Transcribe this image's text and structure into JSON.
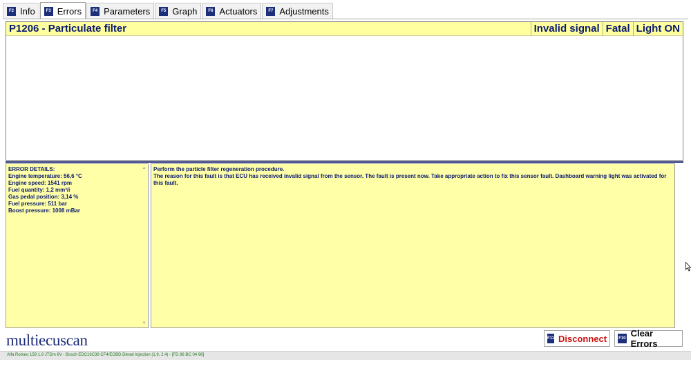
{
  "tabs": [
    {
      "key": "F2",
      "label": "Info"
    },
    {
      "key": "F3",
      "label": "Errors"
    },
    {
      "key": "F4",
      "label": "Parameters"
    },
    {
      "key": "F5",
      "label": "Graph"
    },
    {
      "key": "F6",
      "label": "Actuators"
    },
    {
      "key": "F7",
      "label": "Adjustments"
    }
  ],
  "active_tab": "Errors",
  "fault": {
    "title": "P1206 - Particulate filter",
    "type": "Invalid signal",
    "severity": "Fatal",
    "light": "Light ON"
  },
  "details": {
    "heading": "ERROR DETAILS:",
    "lines": [
      "Engine temperature: 56,6 °C",
      "Engine speed: 1541 rpm",
      "Fuel quantity: 1,2 mm³/i",
      "Gas pedal position: 3,14 %",
      "Fuel pressure: 511 bar",
      "Boost pressure: 1008 mBar"
    ]
  },
  "description": {
    "line1": "Perform the particle filter regeneration procedure.",
    "line2": "The reason for this fault is that ECU has received invalid signal from the sensor. The fault is present now. Take appropriate action to fix this sensor fault. Dashboard warning light was activated for this fault."
  },
  "logo": "multiecuscan",
  "buttons": {
    "disconnect": {
      "key": "F11",
      "label": "Disconnect"
    },
    "clear": {
      "key": "F10",
      "label": "Clear Errors"
    }
  },
  "status": "Alfa Romeo 159 1.9 JTDm 8V - Bosch EDC16C39 CF4/EOBD Diesel Injection (1.9, 2.4) - [FD 86 BC 04 98]",
  "colors": {
    "navy": "#1c2f7a",
    "highlight_yellow": "#ffff9f",
    "panel_yellow": "#ffffa8",
    "danger_red": "#cc1111",
    "status_green": "#1a7a1a"
  }
}
